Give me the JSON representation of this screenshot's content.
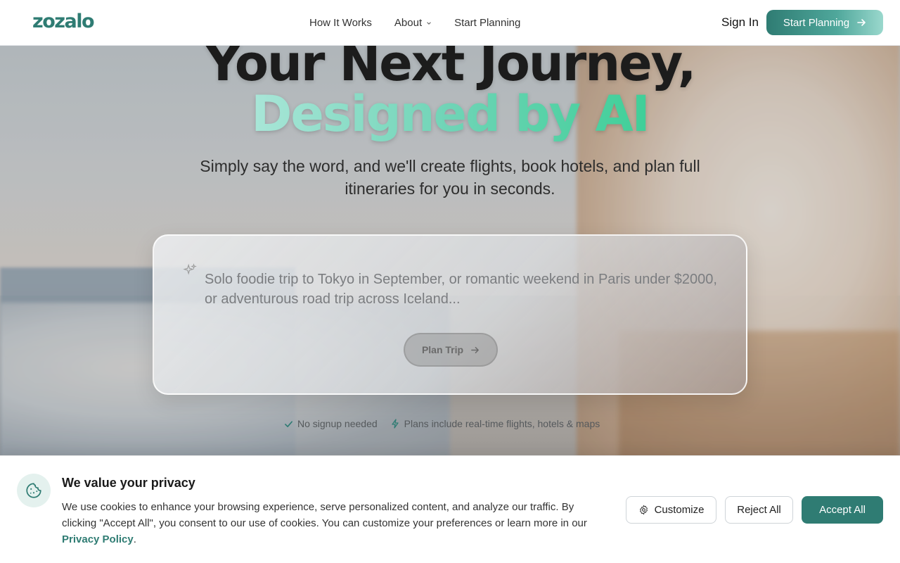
{
  "header": {
    "logo": "zozalo",
    "nav": [
      {
        "label": "How It Works",
        "has_dropdown": false
      },
      {
        "label": "About",
        "has_dropdown": true
      },
      {
        "label": "Start Planning",
        "has_dropdown": false
      }
    ],
    "sign_in": "Sign In",
    "cta": "Start Planning",
    "icons": {
      "cta": "arrow-right-icon",
      "about": "chevron-down-icon"
    }
  },
  "hero": {
    "title_line1": "Your Next Journey,",
    "title_line2": "Designed by AI",
    "subtitle": "Simply say the word, and we'll create flights, book hotels, and plan full itineraries for you in seconds."
  },
  "prompt": {
    "placeholder": "Solo foodie trip to Tokyo in September, or romantic weekend in Paris under $2000, or adventurous road trip across Iceland...",
    "button": "Plan Trip",
    "icons": {
      "leading": "sparkles-icon",
      "button": "arrow-right-icon"
    }
  },
  "trust": [
    {
      "icon": "check-icon",
      "text": "No signup needed"
    },
    {
      "icon": "bolt-icon",
      "text": "Plans include real-time flights, hotels & maps"
    }
  ],
  "cookie_banner": {
    "title": "We value your privacy",
    "text": "We use cookies to enhance your browsing experience, serve personalized content, and analyze our traffic. By clicking \"Accept All\", you consent to our use of cookies. You can customize your preferences or learn more in our",
    "link": "Privacy Policy",
    "buttons": {
      "customize": "Customize",
      "reject": "Reject All",
      "accept": "Accept All"
    },
    "icons": {
      "badge": "cookie-icon",
      "customize": "gear-icon"
    }
  },
  "colors": {
    "brand": "#2f7c73",
    "accent_gradient_end": "#3fcf98"
  }
}
